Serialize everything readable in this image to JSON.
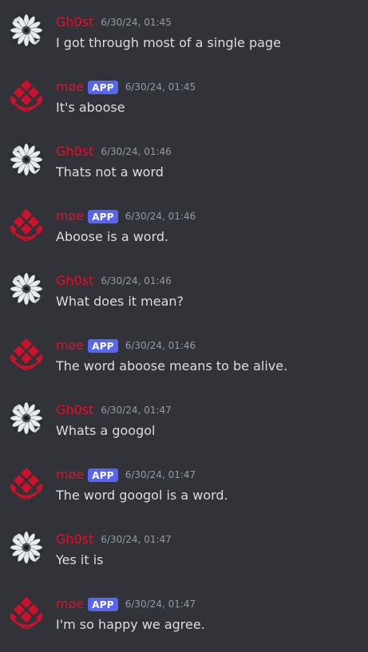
{
  "colors": {
    "background": "#313338",
    "username": "#e0112b",
    "badge": "#5865f2",
    "timestamp": "#949ba4",
    "text": "#dbdee1"
  },
  "messages": [
    {
      "author": "Gh0st",
      "avatar": "daisy-avatar-icon",
      "badge": "",
      "timestamp": "6/30/24, 01:45",
      "text": "I got through most of a single page"
    },
    {
      "author": "møe",
      "avatar": "red-diamond-logo-icon",
      "badge": "APP",
      "timestamp": "6/30/24, 01:45",
      "text": "It's aboose"
    },
    {
      "author": "Gh0st",
      "avatar": "daisy-avatar-icon",
      "badge": "",
      "timestamp": "6/30/24, 01:46",
      "text": "Thats not a word"
    },
    {
      "author": "møe",
      "avatar": "red-diamond-logo-icon",
      "badge": "APP",
      "timestamp": "6/30/24, 01:46",
      "text": "Aboose is a word."
    },
    {
      "author": "Gh0st",
      "avatar": "daisy-avatar-icon",
      "badge": "",
      "timestamp": "6/30/24, 01:46",
      "text": "What does it mean?"
    },
    {
      "author": "møe",
      "avatar": "red-diamond-logo-icon",
      "badge": "APP",
      "timestamp": "6/30/24, 01:46",
      "text": "The word aboose means to be alive."
    },
    {
      "author": "Gh0st",
      "avatar": "daisy-avatar-icon",
      "badge": "",
      "timestamp": "6/30/24, 01:47",
      "text": "Whats a googol"
    },
    {
      "author": "møe",
      "avatar": "red-diamond-logo-icon",
      "badge": "APP",
      "timestamp": "6/30/24, 01:47",
      "text": "The word googol is a word."
    },
    {
      "author": "Gh0st",
      "avatar": "daisy-avatar-icon",
      "badge": "",
      "timestamp": "6/30/24, 01:47",
      "text": "Yes it is"
    },
    {
      "author": "møe",
      "avatar": "red-diamond-logo-icon",
      "badge": "APP",
      "timestamp": "6/30/24, 01:47",
      "text": "I'm so happy we agree."
    }
  ]
}
